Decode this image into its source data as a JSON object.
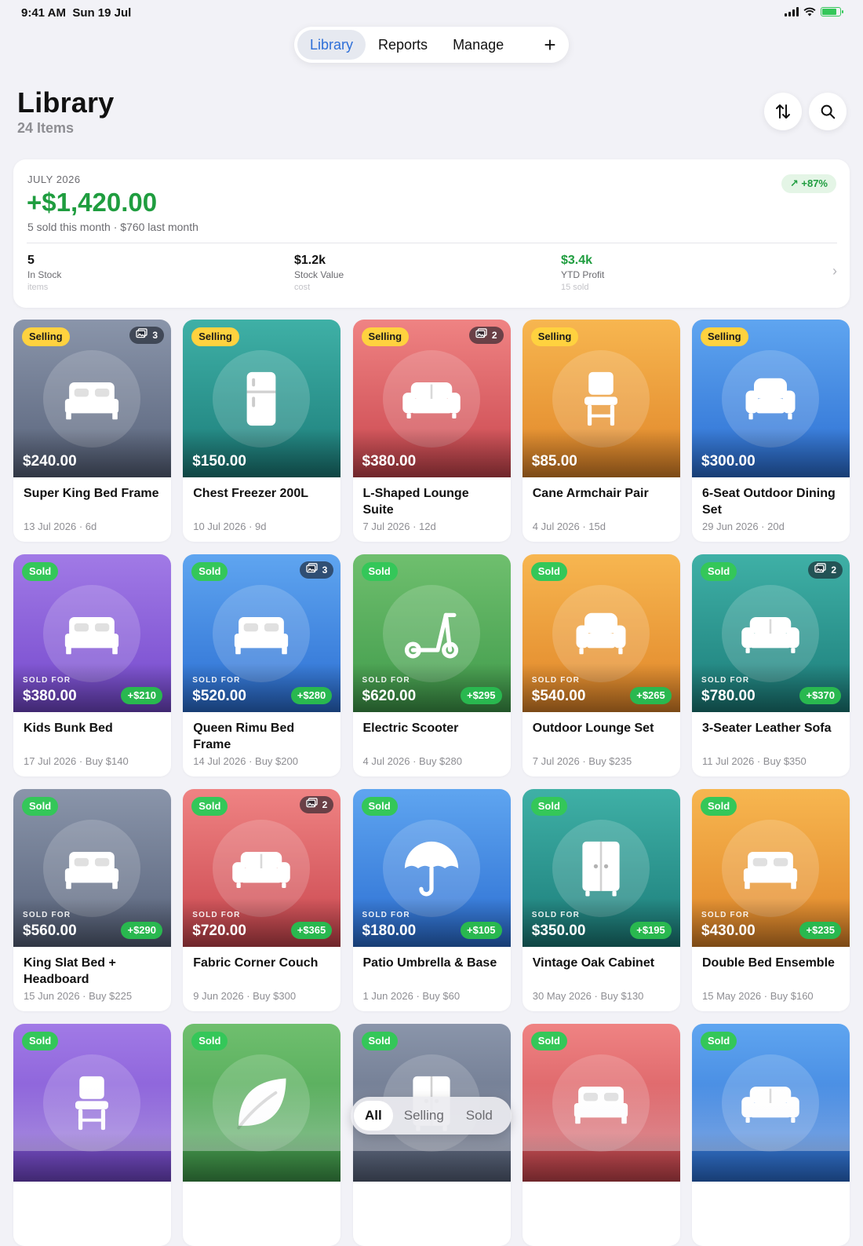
{
  "status_bar": {
    "time": "9:41 AM",
    "date": "Sun 19 Jul"
  },
  "nav": {
    "tabs": [
      "Library",
      "Reports",
      "Manage"
    ],
    "active": "Library",
    "add_label": "+"
  },
  "header": {
    "title": "Library",
    "subtitle": "24 Items"
  },
  "summary": {
    "month": "JULY 2026",
    "amount": "+$1,420.00",
    "subtitle": "5 sold this month · $760 last month",
    "badge": "+87%",
    "stats": [
      {
        "value": "5",
        "label": "In Stock",
        "caption": "items"
      },
      {
        "value": "$1.2k",
        "label": "Stock Value",
        "caption": "cost"
      },
      {
        "value": "$3.4k",
        "label": "YTD Profit",
        "caption": "15 sold"
      }
    ]
  },
  "colors": {
    "profit_green": "#1f9d3f",
    "accent_blue": "#2e6fd8",
    "selling_badge": "#ffd23f",
    "sold_badge": "#34c759"
  },
  "labels": {
    "sold_for": "SOLD FOR"
  },
  "items": [
    {
      "status": "Selling",
      "photos": "3",
      "price": "$240.00",
      "name": "Super King Bed Frame",
      "meta": "13 Jul 2026 · 6d",
      "icon": "bed-icon",
      "theme": "slate"
    },
    {
      "status": "Selling",
      "price": "$150.00",
      "name": "Chest Freezer 200L",
      "meta": "10 Jul 2026 · 9d",
      "icon": "fridge-icon",
      "theme": "teal"
    },
    {
      "status": "Selling",
      "photos": "2",
      "price": "$380.00",
      "name": "L-Shaped Lounge Suite",
      "meta": "7 Jul 2026 · 12d",
      "icon": "sofa-icon",
      "theme": "red"
    },
    {
      "status": "Selling",
      "price": "$85.00",
      "name": "Cane Armchair Pair",
      "meta": "4 Jul 2026 · 15d",
      "icon": "chair-icon",
      "theme": "orange"
    },
    {
      "status": "Selling",
      "price": "$300.00",
      "name": "6-Seat Outdoor Dining Set",
      "meta": "29 Jun 2026 · 20d",
      "icon": "armchair-icon",
      "theme": "blue"
    },
    {
      "status": "Sold",
      "price": "$380.00",
      "profit": "+$210",
      "name": "Kids Bunk Bed",
      "meta": "17 Jul 2026 · Buy $140",
      "icon": "bed-icon",
      "theme": "purple"
    },
    {
      "status": "Sold",
      "photos": "3",
      "price": "$520.00",
      "profit": "+$280",
      "name": "Queen Rimu Bed Frame",
      "meta": "14 Jul 2026 · Buy $200",
      "icon": "bed-icon",
      "theme": "blue"
    },
    {
      "status": "Sold",
      "price": "$620.00",
      "profit": "+$295",
      "name": "Electric Scooter",
      "meta": "4 Jul 2026 · Buy $280",
      "icon": "scooter-icon",
      "theme": "green"
    },
    {
      "status": "Sold",
      "price": "$540.00",
      "profit": "+$265",
      "name": "Outdoor Lounge Set",
      "meta": "7 Jul 2026 · Buy $235",
      "icon": "armchair-icon",
      "theme": "orange"
    },
    {
      "status": "Sold",
      "photos": "2",
      "price": "$780.00",
      "profit": "+$370",
      "name": "3-Seater Leather Sofa",
      "meta": "11 Jul 2026 · Buy $350",
      "icon": "sofa-icon",
      "theme": "teal"
    },
    {
      "status": "Sold",
      "price": "$560.00",
      "profit": "+$290",
      "name": "King Slat Bed + Headboard",
      "meta": "15 Jun 2026 · Buy $225",
      "icon": "bed-icon",
      "theme": "slate"
    },
    {
      "status": "Sold",
      "photos": "2",
      "price": "$720.00",
      "profit": "+$365",
      "name": "Fabric Corner Couch",
      "meta": "9 Jun 2026 · Buy $300",
      "icon": "sofa-icon",
      "theme": "red"
    },
    {
      "status": "Sold",
      "price": "$180.00",
      "profit": "+$105",
      "name": "Patio Umbrella & Base",
      "meta": "1 Jun 2026 · Buy $60",
      "icon": "umbrella-icon",
      "theme": "blue"
    },
    {
      "status": "Sold",
      "price": "$350.00",
      "profit": "+$195",
      "name": "Vintage Oak Cabinet",
      "meta": "30 May 2026 · Buy $130",
      "icon": "cabinet-icon",
      "theme": "teal"
    },
    {
      "status": "Sold",
      "price": "$430.00",
      "profit": "+$235",
      "name": "Double Bed Ensemble",
      "meta": "15 May 2026 · Buy $160",
      "icon": "bed-icon",
      "theme": "orange"
    },
    {
      "status": "Sold",
      "icon": "chair-icon",
      "theme": "purple"
    },
    {
      "status": "Sold",
      "icon": "leaf-icon",
      "theme": "green"
    },
    {
      "status": "Sold",
      "icon": "cabinet-icon",
      "theme": "slate"
    },
    {
      "status": "Sold",
      "icon": "bed-icon",
      "theme": "red"
    },
    {
      "status": "Sold",
      "icon": "sofa-icon",
      "theme": "blue"
    }
  ],
  "filter": {
    "options": [
      "All",
      "Selling",
      "Sold"
    ],
    "active": "All"
  }
}
